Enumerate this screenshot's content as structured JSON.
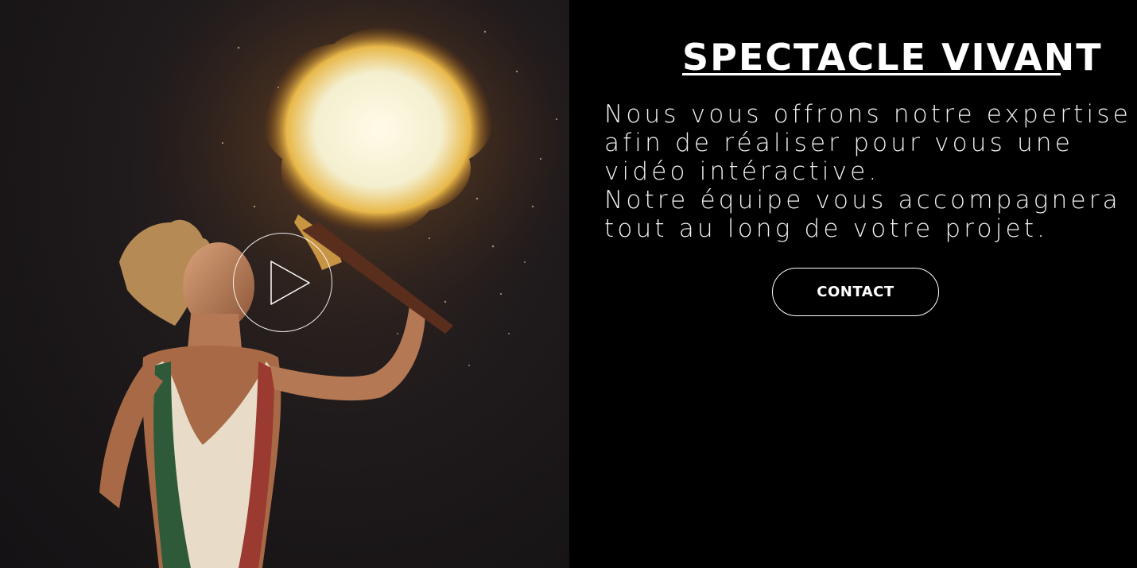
{
  "hero": {
    "image_alt": "Fire breather performer",
    "play_icon": "play-icon"
  },
  "section": {
    "title": "SPECTACLE VIVANT",
    "description_lines": [
      "Nous vous offrons notre expertise",
      "afin de réaliser pour vous une",
      "vidéo intéractive.",
      "Notre équipe vous accompagnera",
      "tout au long de votre projet."
    ],
    "contact_label": "CONTACT"
  },
  "colors": {
    "background": "#000000",
    "text": "#ffffff",
    "fire": "#f5f0d8"
  }
}
